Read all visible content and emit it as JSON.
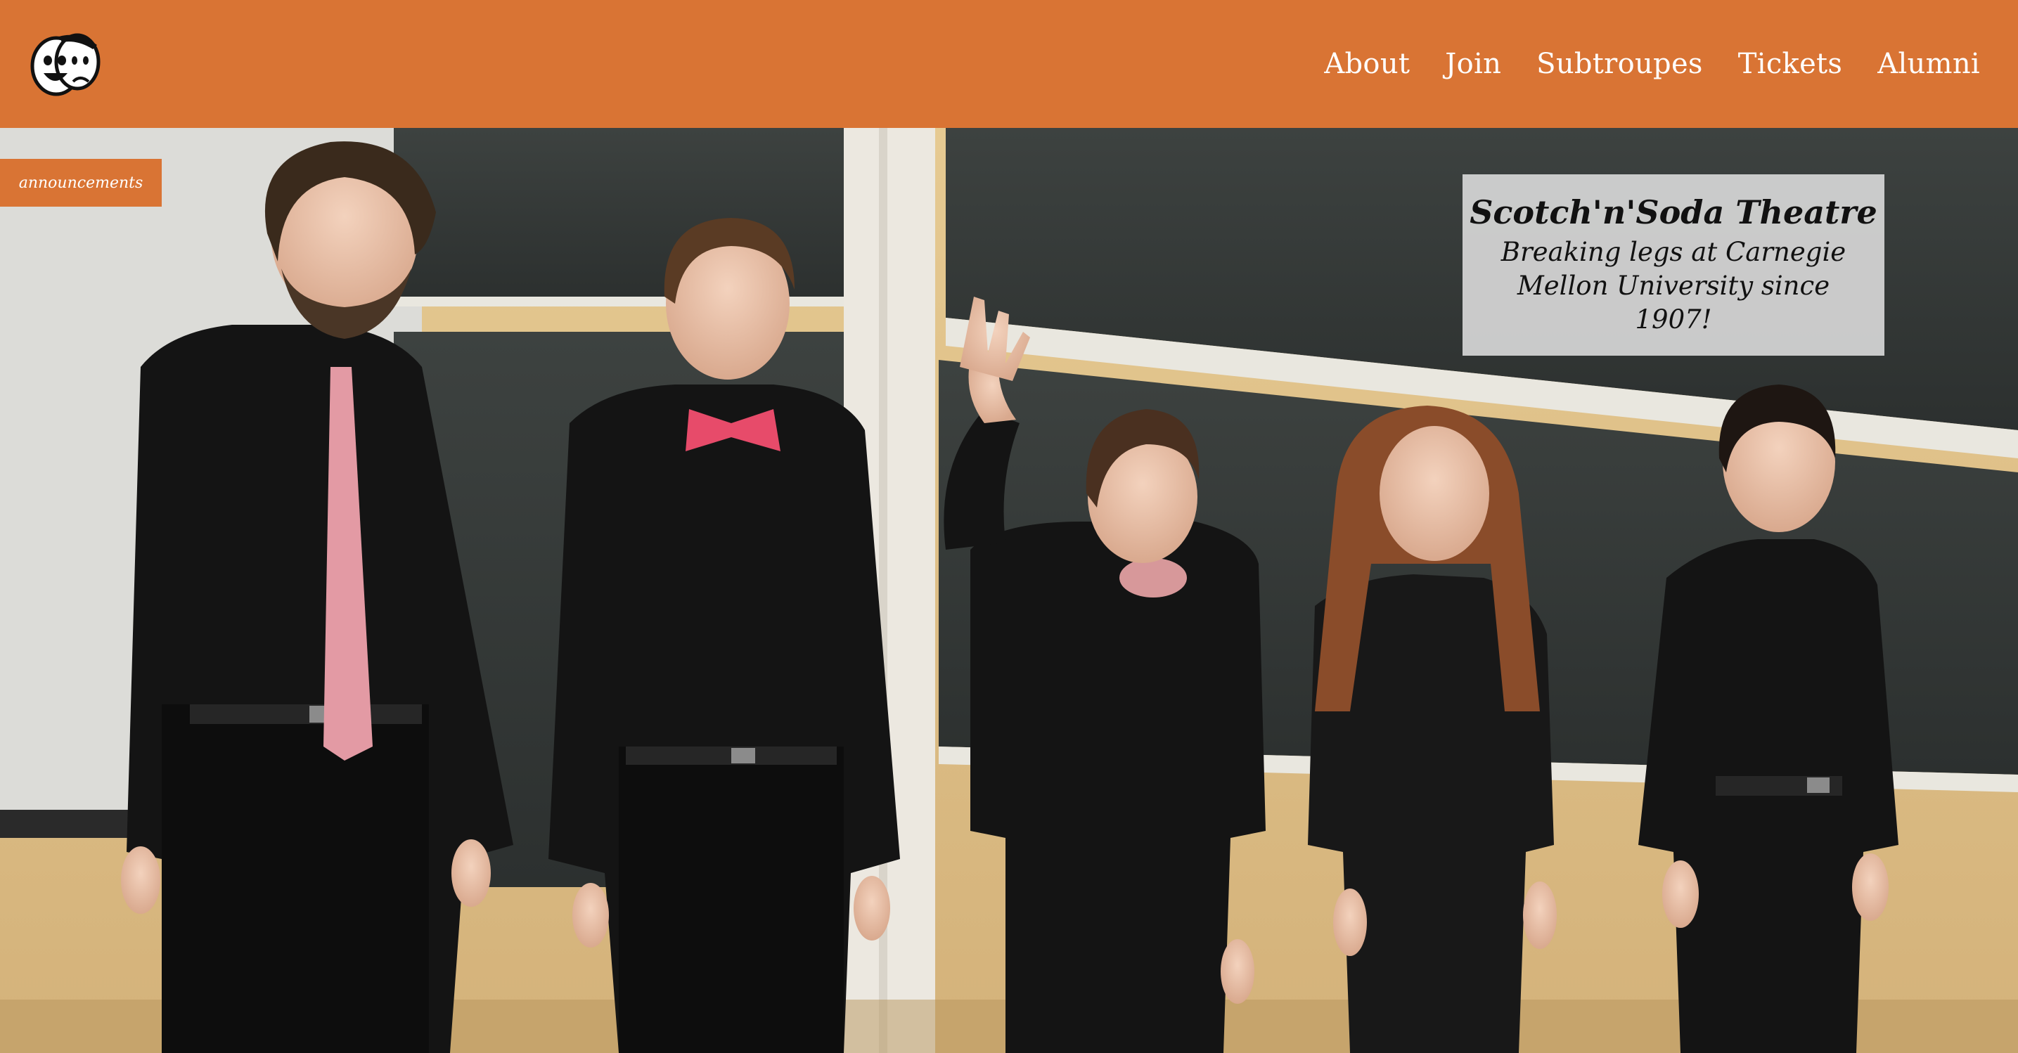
{
  "header": {
    "logo_icon": "comedy-tragedy-masks-icon",
    "nav": [
      {
        "label": "About"
      },
      {
        "label": "Join"
      },
      {
        "label": "Subtroupes"
      },
      {
        "label": "Tickets"
      },
      {
        "label": "Alumni"
      }
    ],
    "bar_color": "#d97434"
  },
  "announcements": {
    "label": "announcements"
  },
  "hero": {
    "caption_title": "Scotch'n'Soda Theatre",
    "caption_subtitle": "Breaking legs at Carnegie Mellon University since 1907!"
  }
}
